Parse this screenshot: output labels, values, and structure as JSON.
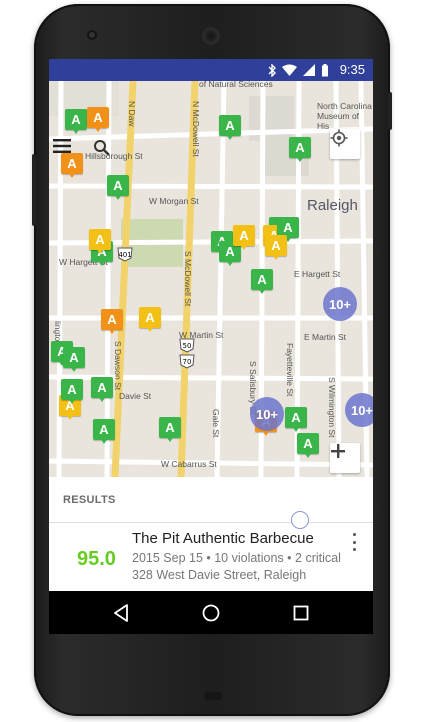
{
  "status_bar": {
    "time": "9:35"
  },
  "map": {
    "city_label": "Raleigh",
    "streets": {
      "hillsborough": "Hillsborough St",
      "morgan": "W Morgan St",
      "hargett_w": "W Hargett St",
      "hargett_e": "E Hargett St",
      "martin_w": "W Martin St",
      "martin_e": "E Martin St",
      "davie": "Davie St",
      "cabarrus": "W Cabarrus St",
      "dawson": "S Dawson St",
      "mcdowell_n": "N McDowell St",
      "mcdowell_s": "S McDowell St",
      "salisbury": "S Salisbury St",
      "fayetteville": "Fayetteville St",
      "wilmington": "S Wilmington St",
      "gale": "Gale St",
      "lington": "lington St",
      "n_daw": "N Daw",
      "museum": "North Carolina Museum of His",
      "natural_sciences": "of Natural Sciences"
    },
    "route_shields": [
      "401",
      "70",
      "50"
    ],
    "markers": [
      {
        "grade": "A",
        "color": "green"
      },
      {
        "grade": "A",
        "color": "orange"
      },
      {
        "grade": "A",
        "color": "green"
      },
      {
        "grade": "A",
        "color": "green"
      },
      {
        "grade": "A",
        "color": "orange"
      },
      {
        "grade": "A",
        "color": "green"
      },
      {
        "grade": "A",
        "color": "green"
      },
      {
        "grade": "A",
        "color": "yellow"
      },
      {
        "grade": "A",
        "color": "green"
      },
      {
        "grade": "A",
        "color": "green"
      },
      {
        "grade": "A",
        "color": "yellow"
      },
      {
        "grade": "A",
        "color": "green"
      },
      {
        "grade": "A",
        "color": "yellow"
      },
      {
        "grade": "A",
        "color": "green"
      },
      {
        "grade": "A",
        "color": "yellow"
      },
      {
        "grade": "A",
        "color": "green"
      },
      {
        "grade": "A",
        "color": "orange"
      },
      {
        "grade": "A",
        "color": "yellow"
      },
      {
        "grade": "A",
        "color": "green"
      },
      {
        "grade": "A",
        "color": "green"
      },
      {
        "grade": "A",
        "color": "green"
      },
      {
        "grade": "A",
        "color": "yellow"
      },
      {
        "grade": "A",
        "color": "green"
      },
      {
        "grade": "A",
        "color": "green"
      },
      {
        "grade": "A",
        "color": "orange"
      },
      {
        "grade": "A",
        "color": "green"
      },
      {
        "grade": "A",
        "color": "green"
      },
      {
        "grade": "A",
        "color": "green"
      }
    ],
    "clusters": [
      "10+",
      "10+",
      "10+"
    ]
  },
  "toolbar": {
    "menu_icon": "hamburger-menu-icon",
    "search_icon": "search-icon",
    "location_icon": "my-location-icon",
    "zoom_icon": "plus-icon"
  },
  "results": {
    "heading": "RESULTS",
    "item": {
      "score": "95.0",
      "score_color": "#66cc22",
      "name": "The Pit Authentic Barbecue",
      "meta": "2015 Sep 15 • 10 violations • 2 critical",
      "address": "328 West Davie Street, Raleigh"
    }
  },
  "nav": {
    "back_icon": "back-icon",
    "home_icon": "home-icon",
    "recents_icon": "recents-icon"
  },
  "colors": {
    "status_bar": "#2f3f9a",
    "green": "#39b54a",
    "orange": "#f29118",
    "yellow": "#f3c115",
    "cluster": "#6c75cd"
  }
}
